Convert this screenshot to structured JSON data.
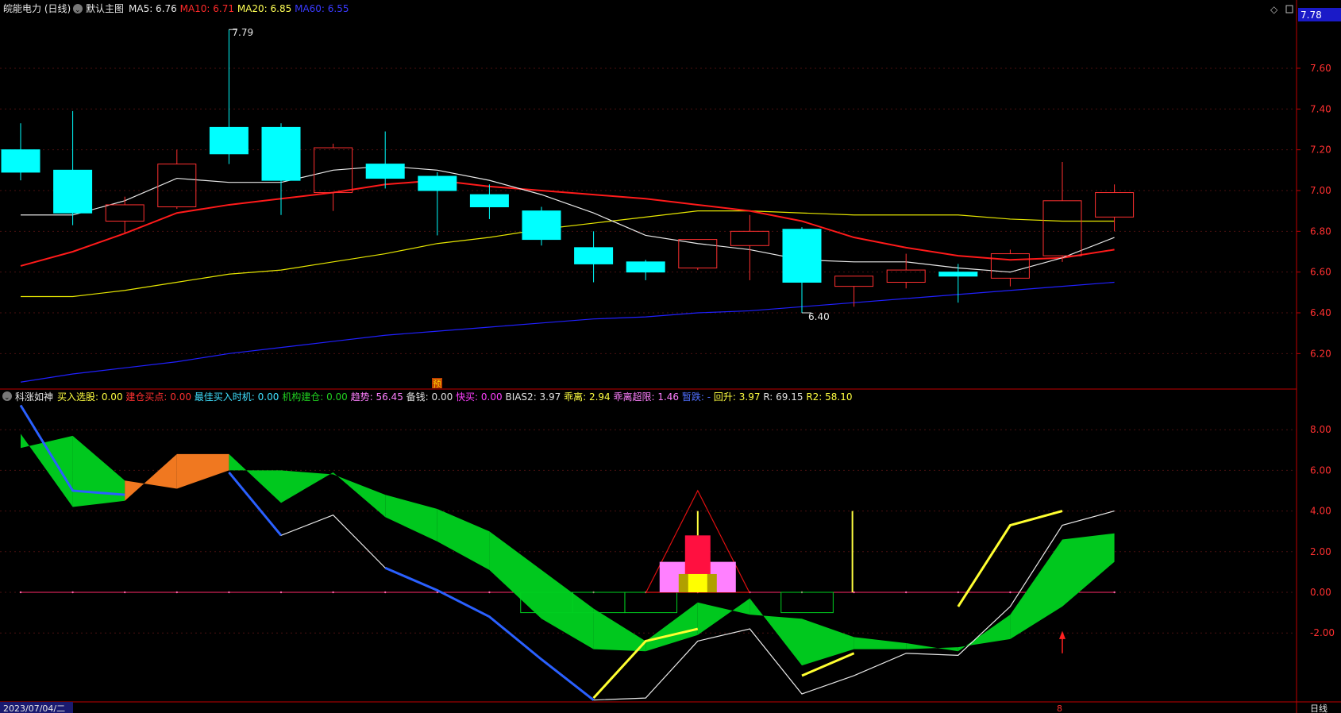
{
  "header": {
    "title": "皖能电力 (日线)",
    "template": "默认主图",
    "ma": [
      {
        "label": "MA5:",
        "value": "6.76",
        "color": "#e8e8e8"
      },
      {
        "label": "MA10:",
        "value": "6.71",
        "color": "#ff2a2a"
      },
      {
        "label": "MA20:",
        "value": "6.85",
        "color": "#ffff55"
      },
      {
        "label": "MA60:",
        "value": "6.55",
        "color": "#3a3aff"
      }
    ],
    "current_price": "7.78"
  },
  "price_axis": {
    "ticks": [
      "7.60",
      "7.40",
      "7.20",
      "7.00",
      "6.80",
      "6.60",
      "6.40",
      "6.20"
    ]
  },
  "annotations": {
    "high": "7.79",
    "low": "6.40",
    "marker": "预"
  },
  "indicator": {
    "name": "科涨如神",
    "fields": [
      {
        "label": "买入选股:",
        "value": "0.00",
        "color": "#ffff40"
      },
      {
        "label": "建仓买点:",
        "value": "0.00",
        "color": "#ff3030"
      },
      {
        "label": "最佳买入时机:",
        "value": "0.00",
        "color": "#40e0ff"
      },
      {
        "label": "机构建仓:",
        "value": "0.00",
        "color": "#20d020"
      },
      {
        "label": "趋势:",
        "value": "56.45",
        "color": "#ff80ff"
      },
      {
        "label": "备钱:",
        "value": "0.00",
        "color": "#e0e0e0"
      },
      {
        "label": "快买:",
        "value": "0.00",
        "color": "#ff40ff"
      },
      {
        "label": "BIAS2:",
        "value": "3.97",
        "color": "#e0e0e0"
      },
      {
        "label": "乖离:",
        "value": "2.94",
        "color": "#ffff40"
      },
      {
        "label": "乖离超限:",
        "value": "1.46",
        "color": "#ff80ff"
      },
      {
        "label": "暂跌:",
        "value": "-",
        "color": "#5070ff"
      },
      {
        "label": "回升:",
        "value": "3.97",
        "color": "#ffff40"
      },
      {
        "label": "R:",
        "value": "69.15",
        "color": "#e0e0e0"
      },
      {
        "label": "R2:",
        "value": "58.10",
        "color": "#ffff40"
      }
    ],
    "ticks": [
      "8.00",
      "6.00",
      "4.00",
      "2.00",
      "0.00",
      "-2.00"
    ]
  },
  "footer": {
    "date": "2023/07/04/二",
    "period": "日线",
    "marker": "8"
  },
  "colors": {
    "up": "#ff3030",
    "down": "#00ffff",
    "ma5": "#e8e8e8",
    "ma10": "#ff1a1a",
    "ma20": "#e6e600",
    "ma60": "#2020ff"
  },
  "chart_data": {
    "type": "candlestick",
    "candles": [
      {
        "o": 7.2,
        "h": 7.33,
        "l": 7.05,
        "c": 7.09
      },
      {
        "o": 7.1,
        "h": 7.39,
        "l": 6.83,
        "c": 6.89
      },
      {
        "o": 6.85,
        "h": 6.97,
        "l": 6.79,
        "c": 6.93
      },
      {
        "o": 6.92,
        "h": 7.2,
        "l": 6.91,
        "c": 7.13
      },
      {
        "o": 7.31,
        "h": 7.79,
        "l": 7.13,
        "c": 7.18
      },
      {
        "o": 7.31,
        "h": 7.33,
        "l": 6.88,
        "c": 7.05
      },
      {
        "o": 6.99,
        "h": 7.23,
        "l": 6.9,
        "c": 7.21
      },
      {
        "o": 7.13,
        "h": 7.29,
        "l": 7.01,
        "c": 7.06
      },
      {
        "o": 7.07,
        "h": 7.09,
        "l": 6.78,
        "c": 7.0
      },
      {
        "o": 6.98,
        "h": 7.03,
        "l": 6.86,
        "c": 6.92
      },
      {
        "o": 6.9,
        "h": 6.92,
        "l": 6.73,
        "c": 6.76
      },
      {
        "o": 6.72,
        "h": 6.8,
        "l": 6.55,
        "c": 6.64
      },
      {
        "o": 6.65,
        "h": 6.66,
        "l": 6.56,
        "c": 6.6
      },
      {
        "o": 6.62,
        "h": 6.76,
        "l": 6.61,
        "c": 6.76
      },
      {
        "o": 6.73,
        "h": 6.88,
        "l": 6.56,
        "c": 6.8
      },
      {
        "o": 6.81,
        "h": 6.82,
        "l": 6.4,
        "c": 6.55
      },
      {
        "o": 6.53,
        "h": 6.58,
        "l": 6.43,
        "c": 6.58
      },
      {
        "o": 6.55,
        "h": 6.69,
        "l": 6.52,
        "c": 6.61
      },
      {
        "o": 6.6,
        "h": 6.64,
        "l": 6.45,
        "c": 6.58
      },
      {
        "o": 6.57,
        "h": 6.71,
        "l": 6.53,
        "c": 6.69
      },
      {
        "o": 6.68,
        "h": 7.14,
        "l": 6.65,
        "c": 6.95
      },
      {
        "o": 6.87,
        "h": 7.03,
        "l": 6.8,
        "c": 6.99
      }
    ],
    "ma5": [
      6.88,
      6.88,
      6.95,
      7.06,
      7.04,
      7.04,
      7.1,
      7.12,
      7.1,
      7.05,
      6.98,
      6.89,
      6.78,
      6.74,
      6.71,
      6.66,
      6.65,
      6.65,
      6.62,
      6.6,
      6.67,
      6.77
    ],
    "ma10": [
      6.63,
      6.7,
      6.79,
      6.89,
      6.93,
      6.96,
      6.99,
      7.03,
      7.05,
      7.02,
      7.0,
      6.98,
      6.96,
      6.93,
      6.9,
      6.85,
      6.77,
      6.72,
      6.68,
      6.66,
      6.67,
      6.71
    ],
    "ma20": [
      6.48,
      6.48,
      6.51,
      6.55,
      6.59,
      6.61,
      6.65,
      6.69,
      6.74,
      6.77,
      6.81,
      6.84,
      6.87,
      6.9,
      6.9,
      6.89,
      6.88,
      6.88,
      6.88,
      6.86,
      6.85,
      6.85
    ],
    "ma60": [
      6.06,
      6.1,
      6.13,
      6.16,
      6.2,
      6.23,
      6.26,
      6.29,
      6.31,
      6.33,
      6.35,
      6.37,
      6.38,
      6.4,
      6.41,
      6.43,
      6.45,
      6.47,
      6.49,
      6.51,
      6.53,
      6.55
    ],
    "indicator": {
      "white": [
        9.2,
        5.0,
        4.8,
        null,
        5.9,
        2.8,
        3.8,
        1.2,
        0.1,
        -1.2,
        -3.3,
        -5.3,
        -5.2,
        -2.4,
        -1.8,
        -5.0,
        -4.1,
        -3.0,
        -3.1,
        -0.7,
        3.3,
        4.0
      ],
      "blue": [
        9.2,
        5.0,
        4.8,
        null,
        5.9,
        2.8,
        null,
        1.2,
        0.1,
        -1.2,
        -3.3,
        -5.3
      ],
      "yellow": [
        null,
        null,
        null,
        null,
        null,
        null,
        null,
        null,
        null,
        null,
        null,
        -5.2,
        -2.4,
        -1.8,
        null,
        -4.1,
        -3.0,
        null,
        -0.7,
        3.3,
        4.0
      ],
      "band_top": [
        7.1,
        7.7,
        5.5,
        5.1,
        6.0,
        6.0,
        5.8,
        4.8,
        4.1,
        3.0,
        1.1,
        -0.8,
        -2.4,
        -0.5,
        -1.1,
        -1.3,
        -2.2,
        -2.5,
        -2.9,
        -1.1,
        2.6,
        2.9
      ],
      "band_bottom": [
        7.8,
        4.2,
        4.5,
        6.8,
        6.8,
        4.4,
        5.9,
        3.7,
        2.5,
        1.1,
        -1.3,
        -2.8,
        -2.9,
        -2.1,
        -0.3,
        -3.6,
        -2.8,
        -2.8,
        -2.7,
        -2.3,
        -0.7,
        1.5
      ],
      "ylim": [
        -5.6,
        9.8
      ]
    }
  }
}
